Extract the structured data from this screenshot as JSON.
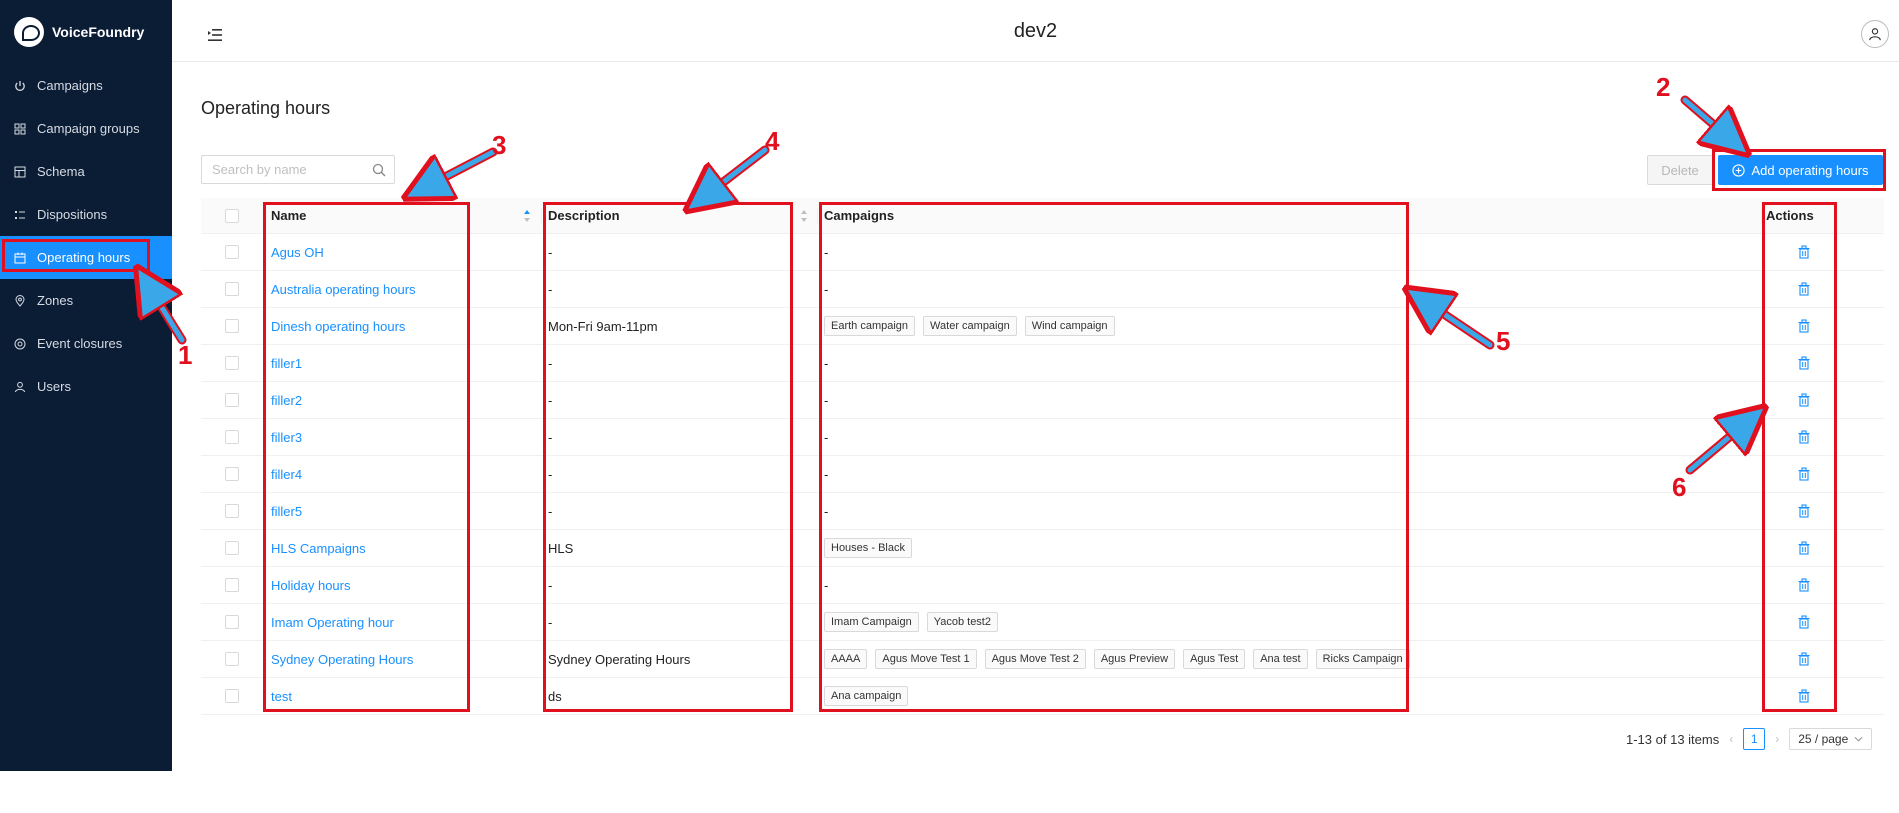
{
  "brand": {
    "name": "VoiceFoundry"
  },
  "sidebar": {
    "items": [
      {
        "label": "Campaigns",
        "icon": "power-icon",
        "active": false
      },
      {
        "label": "Campaign groups",
        "icon": "grid-icon",
        "active": false
      },
      {
        "label": "Schema",
        "icon": "table-icon",
        "active": false
      },
      {
        "label": "Dispositions",
        "icon": "list-icon",
        "active": false
      },
      {
        "label": "Operating hours",
        "icon": "calendar-icon",
        "active": true
      },
      {
        "label": "Zones",
        "icon": "location-icon",
        "active": false
      },
      {
        "label": "Event closures",
        "icon": "target-icon",
        "active": false
      },
      {
        "label": "Users",
        "icon": "user-icon",
        "active": false
      }
    ]
  },
  "header": {
    "title": "dev2"
  },
  "main": {
    "page_title": "Operating hours",
    "search": {
      "placeholder": "Search by name",
      "value": ""
    },
    "delete_label": "Delete",
    "add_label": "Add operating hours"
  },
  "table": {
    "columns": {
      "name": "Name",
      "description": "Description",
      "campaigns": "Campaigns",
      "actions": "Actions"
    },
    "rows": [
      {
        "name": "Agus OH",
        "description": "-",
        "campaigns": [],
        "campaigns_empty": "-"
      },
      {
        "name": "Australia operating hours",
        "description": "-",
        "campaigns": [],
        "campaigns_empty": "-"
      },
      {
        "name": "Dinesh operating hours",
        "description": "Mon-Fri 9am-11pm",
        "campaigns": [
          "Earth campaign",
          "Water campaign",
          "Wind campaign"
        ],
        "campaigns_empty": ""
      },
      {
        "name": "filler1",
        "description": "-",
        "campaigns": [],
        "campaigns_empty": "-"
      },
      {
        "name": "filler2",
        "description": "-",
        "campaigns": [],
        "campaigns_empty": "-"
      },
      {
        "name": "filler3",
        "description": "-",
        "campaigns": [],
        "campaigns_empty": "-"
      },
      {
        "name": "filler4",
        "description": "-",
        "campaigns": [],
        "campaigns_empty": "-"
      },
      {
        "name": "filler5",
        "description": "-",
        "campaigns": [],
        "campaigns_empty": "-"
      },
      {
        "name": "HLS Campaigns",
        "description": "HLS",
        "campaigns": [
          "Houses - Black"
        ],
        "campaigns_empty": ""
      },
      {
        "name": "Holiday hours",
        "description": "-",
        "campaigns": [],
        "campaigns_empty": "-"
      },
      {
        "name": "Imam Operating hour",
        "description": "-",
        "campaigns": [
          "Imam Campaign",
          "Yacob test2"
        ],
        "campaigns_empty": ""
      },
      {
        "name": "Sydney Operating Hours",
        "description": "Sydney Operating Hours",
        "campaigns": [
          "AAAA",
          "Agus Move Test 1",
          "Agus Move Test 2",
          "Agus Preview",
          "Agus Test",
          "Ana test",
          "Ricks Campaign"
        ],
        "campaigns_empty": ""
      },
      {
        "name": "test",
        "description": "ds",
        "campaigns": [
          "Ana campaign"
        ],
        "campaigns_empty": ""
      }
    ]
  },
  "pagination": {
    "summary": "1-13 of 13 items",
    "current_page": "1",
    "page_size": "25 / page"
  },
  "annotations": {
    "labels": [
      "1",
      "2",
      "3",
      "4",
      "5",
      "6"
    ],
    "box_color": "#e0101e",
    "arrow_color": "#3aa8e8"
  },
  "colors": {
    "sidebar_bg": "#0b1c35",
    "accent": "#1890ff"
  }
}
